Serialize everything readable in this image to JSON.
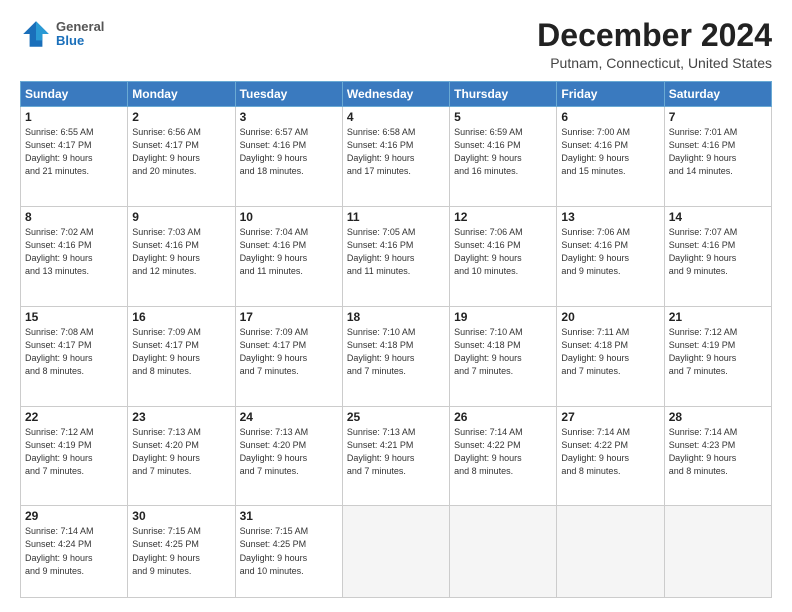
{
  "header": {
    "logo_general": "General",
    "logo_blue": "Blue",
    "month_title": "December 2024",
    "location": "Putnam, Connecticut, United States"
  },
  "days_of_week": [
    "Sunday",
    "Monday",
    "Tuesday",
    "Wednesday",
    "Thursday",
    "Friday",
    "Saturday"
  ],
  "weeks": [
    [
      {
        "day": "1",
        "info": "Sunrise: 6:55 AM\nSunset: 4:17 PM\nDaylight: 9 hours\nand 21 minutes."
      },
      {
        "day": "2",
        "info": "Sunrise: 6:56 AM\nSunset: 4:17 PM\nDaylight: 9 hours\nand 20 minutes."
      },
      {
        "day": "3",
        "info": "Sunrise: 6:57 AM\nSunset: 4:16 PM\nDaylight: 9 hours\nand 18 minutes."
      },
      {
        "day": "4",
        "info": "Sunrise: 6:58 AM\nSunset: 4:16 PM\nDaylight: 9 hours\nand 17 minutes."
      },
      {
        "day": "5",
        "info": "Sunrise: 6:59 AM\nSunset: 4:16 PM\nDaylight: 9 hours\nand 16 minutes."
      },
      {
        "day": "6",
        "info": "Sunrise: 7:00 AM\nSunset: 4:16 PM\nDaylight: 9 hours\nand 15 minutes."
      },
      {
        "day": "7",
        "info": "Sunrise: 7:01 AM\nSunset: 4:16 PM\nDaylight: 9 hours\nand 14 minutes."
      }
    ],
    [
      {
        "day": "8",
        "info": "Sunrise: 7:02 AM\nSunset: 4:16 PM\nDaylight: 9 hours\nand 13 minutes."
      },
      {
        "day": "9",
        "info": "Sunrise: 7:03 AM\nSunset: 4:16 PM\nDaylight: 9 hours\nand 12 minutes."
      },
      {
        "day": "10",
        "info": "Sunrise: 7:04 AM\nSunset: 4:16 PM\nDaylight: 9 hours\nand 11 minutes."
      },
      {
        "day": "11",
        "info": "Sunrise: 7:05 AM\nSunset: 4:16 PM\nDaylight: 9 hours\nand 11 minutes."
      },
      {
        "day": "12",
        "info": "Sunrise: 7:06 AM\nSunset: 4:16 PM\nDaylight: 9 hours\nand 10 minutes."
      },
      {
        "day": "13",
        "info": "Sunrise: 7:06 AM\nSunset: 4:16 PM\nDaylight: 9 hours\nand 9 minutes."
      },
      {
        "day": "14",
        "info": "Sunrise: 7:07 AM\nSunset: 4:16 PM\nDaylight: 9 hours\nand 9 minutes."
      }
    ],
    [
      {
        "day": "15",
        "info": "Sunrise: 7:08 AM\nSunset: 4:17 PM\nDaylight: 9 hours\nand 8 minutes."
      },
      {
        "day": "16",
        "info": "Sunrise: 7:09 AM\nSunset: 4:17 PM\nDaylight: 9 hours\nand 8 minutes."
      },
      {
        "day": "17",
        "info": "Sunrise: 7:09 AM\nSunset: 4:17 PM\nDaylight: 9 hours\nand 7 minutes."
      },
      {
        "day": "18",
        "info": "Sunrise: 7:10 AM\nSunset: 4:18 PM\nDaylight: 9 hours\nand 7 minutes."
      },
      {
        "day": "19",
        "info": "Sunrise: 7:10 AM\nSunset: 4:18 PM\nDaylight: 9 hours\nand 7 minutes."
      },
      {
        "day": "20",
        "info": "Sunrise: 7:11 AM\nSunset: 4:18 PM\nDaylight: 9 hours\nand 7 minutes."
      },
      {
        "day": "21",
        "info": "Sunrise: 7:12 AM\nSunset: 4:19 PM\nDaylight: 9 hours\nand 7 minutes."
      }
    ],
    [
      {
        "day": "22",
        "info": "Sunrise: 7:12 AM\nSunset: 4:19 PM\nDaylight: 9 hours\nand 7 minutes."
      },
      {
        "day": "23",
        "info": "Sunrise: 7:13 AM\nSunset: 4:20 PM\nDaylight: 9 hours\nand 7 minutes."
      },
      {
        "day": "24",
        "info": "Sunrise: 7:13 AM\nSunset: 4:20 PM\nDaylight: 9 hours\nand 7 minutes."
      },
      {
        "day": "25",
        "info": "Sunrise: 7:13 AM\nSunset: 4:21 PM\nDaylight: 9 hours\nand 7 minutes."
      },
      {
        "day": "26",
        "info": "Sunrise: 7:14 AM\nSunset: 4:22 PM\nDaylight: 9 hours\nand 8 minutes."
      },
      {
        "day": "27",
        "info": "Sunrise: 7:14 AM\nSunset: 4:22 PM\nDaylight: 9 hours\nand 8 minutes."
      },
      {
        "day": "28",
        "info": "Sunrise: 7:14 AM\nSunset: 4:23 PM\nDaylight: 9 hours\nand 8 minutes."
      }
    ],
    [
      {
        "day": "29",
        "info": "Sunrise: 7:14 AM\nSunset: 4:24 PM\nDaylight: 9 hours\nand 9 minutes."
      },
      {
        "day": "30",
        "info": "Sunrise: 7:15 AM\nSunset: 4:25 PM\nDaylight: 9 hours\nand 9 minutes."
      },
      {
        "day": "31",
        "info": "Sunrise: 7:15 AM\nSunset: 4:25 PM\nDaylight: 9 hours\nand 10 minutes."
      },
      {
        "day": "",
        "info": ""
      },
      {
        "day": "",
        "info": ""
      },
      {
        "day": "",
        "info": ""
      },
      {
        "day": "",
        "info": ""
      }
    ]
  ]
}
